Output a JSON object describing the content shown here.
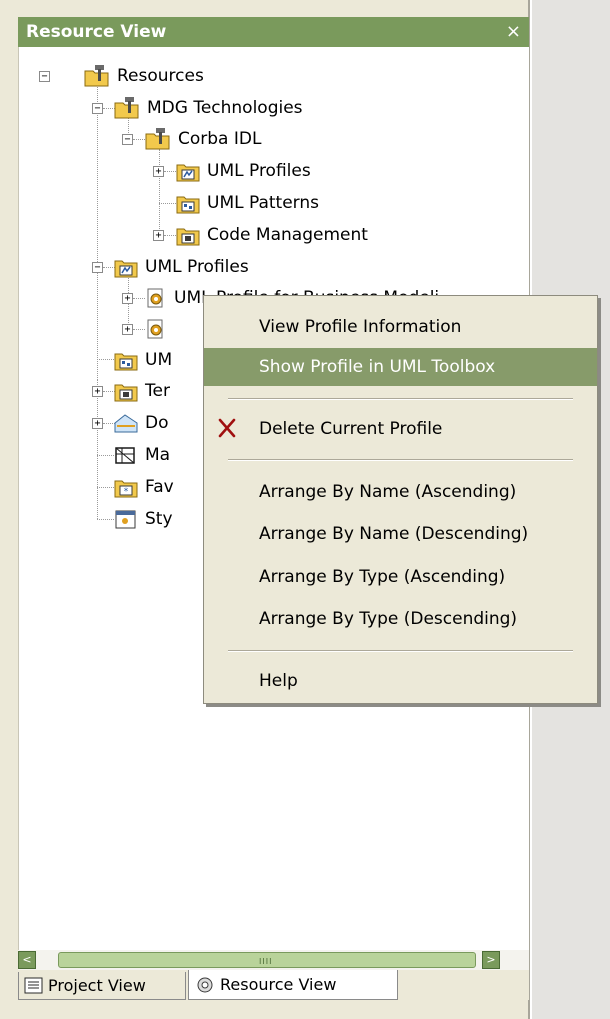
{
  "panel": {
    "title": "Resource View",
    "close_glyph": "×"
  },
  "tree": {
    "resources": "Resources",
    "mdg_technologies": "MDG Technologies",
    "corba_idl": "Corba IDL",
    "corba_uml_profiles": "UML Profiles",
    "corba_uml_patterns": "UML Patterns",
    "corba_code_management": "Code Management",
    "uml_profiles": "UML Profiles",
    "uml_profiles_child1": "UML Profile for Business Modeli",
    "uml_profiles_child2": "",
    "uml_patterns_partial": "UM",
    "templates_partial": "Ter",
    "documents_partial": "Do",
    "matrix_partial": "Ma",
    "favorites_partial": "Fav",
    "styles_partial": "Sty"
  },
  "context_menu": {
    "view_profile_information": "View Profile Information",
    "show_profile_in_toolbox": "Show Profile in UML Toolbox",
    "delete_current_profile": "Delete Current Profile",
    "arrange_name_asc": "Arrange By Name (Ascending)",
    "arrange_name_desc": "Arrange By Name (Descending)",
    "arrange_type_asc": "Arrange By Type (Ascending)",
    "arrange_type_desc": "Arrange By Type (Descending)",
    "help": "Help",
    "highlight_color": "#879b6a"
  },
  "scrollbar": {
    "left_arrow": "<",
    "right_arrow": ">",
    "grip": "IIII"
  },
  "tabs": {
    "project_view": "Project View",
    "resource_view": "Resource View"
  },
  "colors": {
    "title_bar": "#7a9a5c",
    "delete_icon": "#a01010",
    "folder_yellow": "#f2c94c"
  },
  "icons": {
    "resources": "resources-folder-icon",
    "profile": "profile-folder-icon",
    "patterns": "patterns-folder-icon",
    "code": "code-management-icon",
    "stereotype": "stereotype-gear-icon",
    "documents": "documents-icon",
    "matrix": "matrix-icon",
    "favorites": "favorites-icon",
    "styles": "styles-icon",
    "delete": "delete-x-icon",
    "project_view_tab": "project-view-tab-icon",
    "resource_view_tab": "resource-view-tab-icon"
  }
}
